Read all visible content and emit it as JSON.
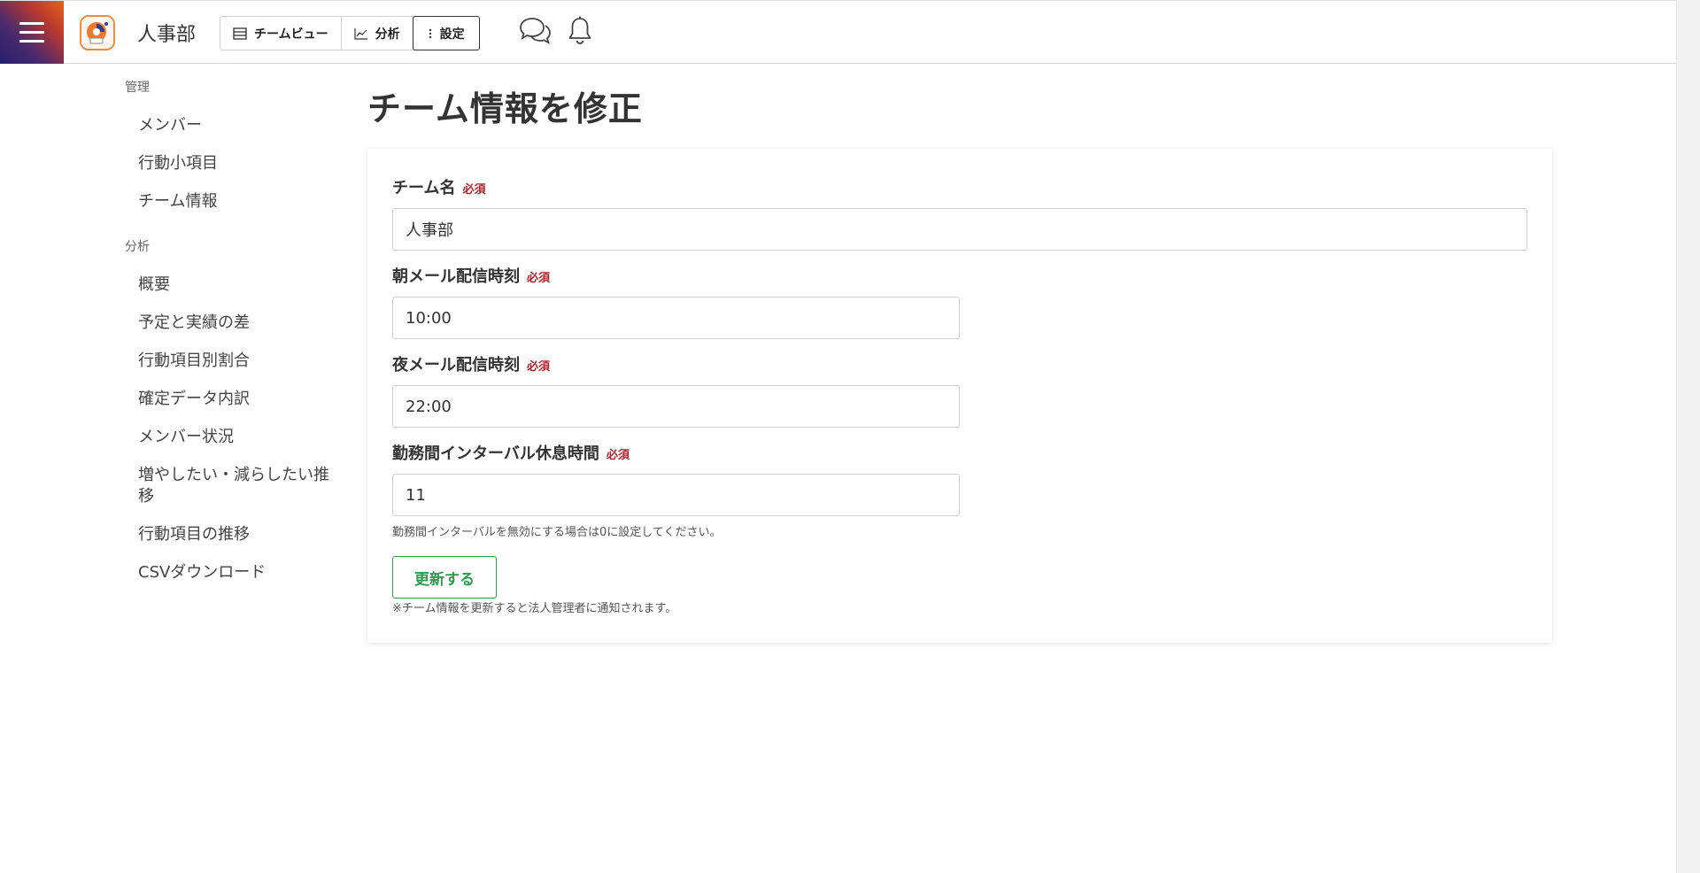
{
  "header": {
    "team_name": "人事部",
    "nav": {
      "team_view": "チームビュー",
      "analysis": "分析",
      "settings": "設定"
    }
  },
  "sidebar": {
    "sections": [
      {
        "title": "管理",
        "items": [
          "メンバー",
          "行動小項目",
          "チーム情報"
        ]
      },
      {
        "title": "分析",
        "items": [
          "概要",
          "予定と実績の差",
          "行動項目別割合",
          "確定データ内訳",
          "メンバー状況",
          "増やしたい・減らしたい推移",
          "行動項目の推移",
          "CSVダウンロード"
        ]
      }
    ]
  },
  "main": {
    "title": "チーム情報を修正",
    "required_label": "必須",
    "fields": {
      "team_name": {
        "label": "チーム名",
        "value": "人事部"
      },
      "morning_mail": {
        "label": "朝メール配信時刻",
        "value": "10:00"
      },
      "night_mail": {
        "label": "夜メール配信時刻",
        "value": "22:00"
      },
      "interval": {
        "label": "勤務間インターバル休息時間",
        "value": "11",
        "help": "勤務間インターバルを無効にする場合は0に設定してください。"
      }
    },
    "submit_label": "更新する",
    "submit_note": "※チーム情報を更新すると法人管理者に通知されます。"
  }
}
